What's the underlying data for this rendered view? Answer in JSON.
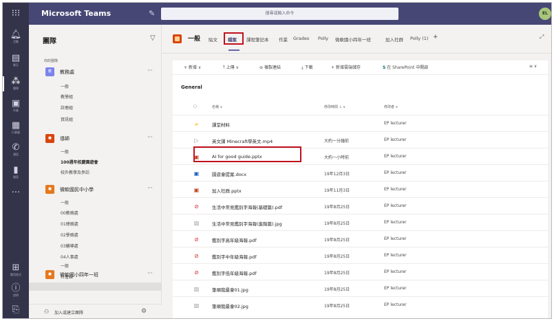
{
  "topbar": {
    "app_title": "Microsoft Teams",
    "search_placeholder": "搜尋或輸入命令",
    "avatar_initials": "EL"
  },
  "rail": [
    {
      "label": "活動",
      "icon": "bell-icon"
    },
    {
      "label": "聊天",
      "icon": "chat-icon"
    },
    {
      "label": "團隊",
      "icon": "teams-icon"
    },
    {
      "label": "作業",
      "icon": "assignments-icon"
    },
    {
      "label": "行事曆",
      "icon": "calendar-icon"
    },
    {
      "label": "通話",
      "icon": "call-icon"
    },
    {
      "label": "檔案",
      "icon": "files-icon"
    },
    {
      "label": "",
      "icon": "more-icon"
    },
    {
      "label": "應用程式",
      "icon": "apps-icon"
    },
    {
      "label": "說明",
      "icon": "help-icon"
    },
    {
      "label": "",
      "icon": "download-icon"
    }
  ],
  "teams_panel": {
    "title": "團隊",
    "your_teams_label": "你的團隊",
    "teams": [
      {
        "name": "教務處",
        "avatar_text": "教",
        "color": "#7b83eb",
        "channels": [
          "一般",
          "教學組",
          "註冊組",
          "資訊組"
        ]
      },
      {
        "name": "導師",
        "avatar_text": "■",
        "color": "#d9450c",
        "channels": [
          "一般",
          "100週年校慶園遊會",
          "校外教學及參訪"
        ]
      },
      {
        "name": "微軟國民中小學",
        "avatar_text": "■",
        "color": "#e6781e",
        "channels": [
          "一般",
          "00教務處",
          "01總務處",
          "02學務處",
          "03輔導處",
          "04人事處"
        ]
      },
      {
        "name": "微軟國小四年一班",
        "avatar_text": "■",
        "color": "#e6781e",
        "channels": [
          "一般",
          "社會課"
        ]
      }
    ],
    "join_label": "加入或建立團隊"
  },
  "channel": {
    "name": "一般",
    "tabs": [
      "貼文",
      "檔案",
      "課程筆記本",
      "作業",
      "Grades",
      "Polly",
      "微軟國小四年一班",
      "加入社群",
      "Polly (1)",
      "+"
    ],
    "active_tab": "檔案"
  },
  "toolbar": {
    "new": "新增",
    "upload": "上傳",
    "copy_link": "複製連結",
    "download": "下載",
    "add_storage": "新增雲端儲存",
    "open_sharepoint": "在 SharePoint 中開啟"
  },
  "files": {
    "folder": "General",
    "columns": {
      "name": "名稱",
      "modified": "修改時間",
      "modified_by": "修改者"
    },
    "rows": [
      {
        "name": "課堂材料",
        "modified": "",
        "modified_by": "EP lecturer",
        "type": "folder"
      },
      {
        "name": "英文課 Minecraft學英文.mp4",
        "modified": "大約一分鐘前",
        "modified_by": "EP lecturer",
        "type": "video"
      },
      {
        "name": "AI for good guide.pptx",
        "modified": "大約一小時前",
        "modified_by": "EP lecturer",
        "type": "pptx"
      },
      {
        "name": "園遊會提案.docx",
        "modified": "19年12月3日",
        "modified_by": "EP lecturer",
        "type": "docx"
      },
      {
        "name": "加入社群.pptx",
        "modified": "19年11月3日",
        "modified_by": "EP lecturer",
        "type": "pptx"
      },
      {
        "name": "生活中常見鑑別字海報(基礎篇).pdf",
        "modified": "19年8月25日",
        "modified_by": "EP lecturer",
        "type": "pdf"
      },
      {
        "name": "生活中常見鑑別字海報(進階篇).jpg",
        "modified": "19年8月25日",
        "modified_by": "EP lecturer",
        "type": "jpg"
      },
      {
        "name": "鑑別字高年級海報.pdf",
        "modified": "19年8月25日",
        "modified_by": "EP lecturer",
        "type": "pdf"
      },
      {
        "name": "鑑別字中年級海報.pdf",
        "modified": "19年8月25日",
        "modified_by": "EP lecturer",
        "type": "pdf"
      },
      {
        "name": "鑑別字低年級海報.pdf",
        "modified": "19年8月25日",
        "modified_by": "EP lecturer",
        "type": "pdf"
      },
      {
        "name": "筆順我最會01.jpg",
        "modified": "19年8月25日",
        "modified_by": "EP lecturer",
        "type": "jpg"
      },
      {
        "name": "筆順我最會02.jpg",
        "modified": "19年8月25日",
        "modified_by": "EP lecturer",
        "type": "jpg"
      }
    ]
  },
  "colors": {
    "header": "#464775",
    "rail": "#33344a",
    "accent": "#6264a7",
    "highlight_box": "#c0101c"
  }
}
